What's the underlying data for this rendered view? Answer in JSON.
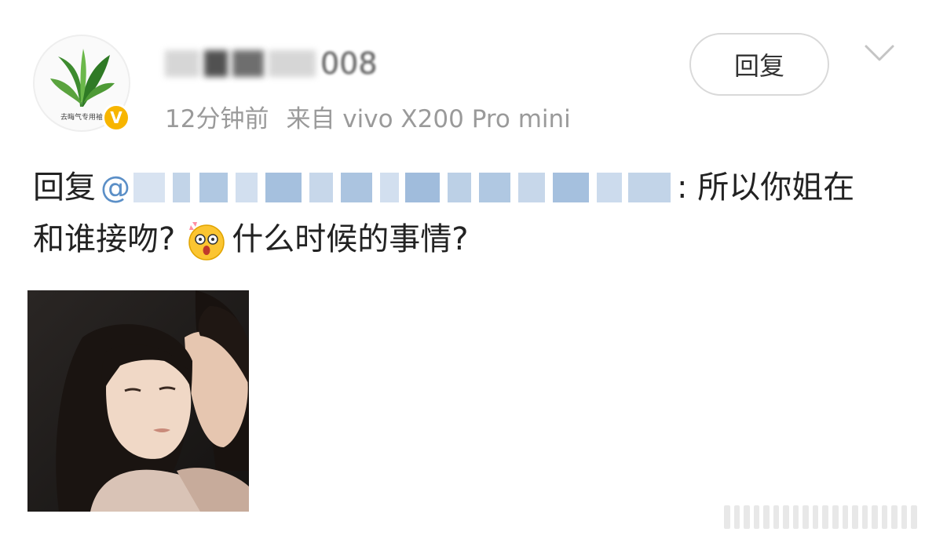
{
  "post": {
    "username_visible_suffix": "008",
    "avatar_caption": "去晦气专用袖",
    "verified_badge": "V",
    "time": "12分钟前",
    "source": "来自 vivo X200 Pro mini",
    "reply_button_label": "回复",
    "content": {
      "prefix": "回复",
      "mention_at": "@",
      "line1_after_mention": ": 所以你姐在",
      "line2_before_emoji": "和谁接吻?",
      "emoji_icon": "shocked-face-emoji",
      "line2_after_emoji": "什么时候的事情?"
    },
    "image_icon": "kiss-photo"
  },
  "colors": {
    "mention_blue": "#5b8fc7",
    "meta_gray": "#9a9a9a",
    "badge_gold": "#f7b500"
  }
}
